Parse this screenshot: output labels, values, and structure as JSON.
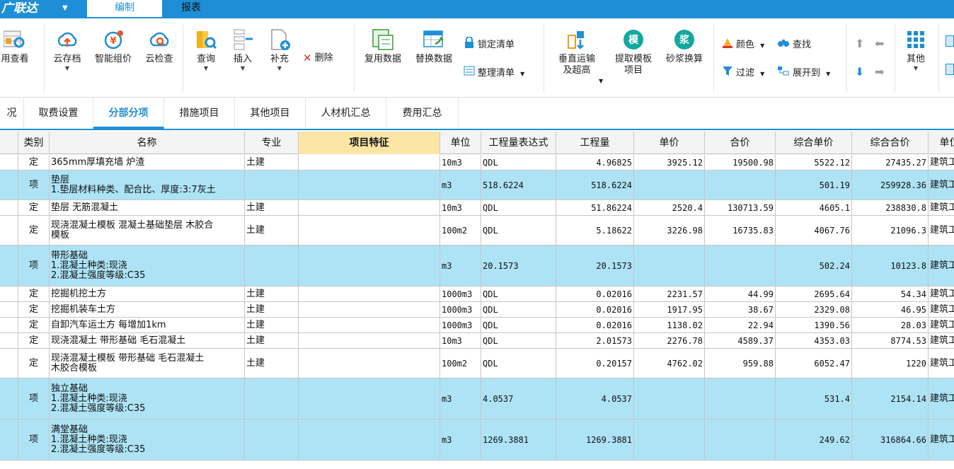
{
  "app": {
    "title": "广联达"
  },
  "menu": {
    "tab_edit": "编制",
    "tab_report": "报表"
  },
  "ribbon": {
    "b_view": "用查看",
    "b_cloud_save": "云存档",
    "b_smart_price": "智能组价",
    "b_cloud_check": "云检查",
    "b_query": "查询",
    "b_insert": "插入",
    "b_supplement": "补充",
    "b_delete": "删除",
    "b_reuse": "复用数据",
    "b_replace": "替换数据",
    "b_lock": "锁定清单",
    "b_arrange": "整理清单",
    "b_vertical_1": "垂直运输",
    "b_vertical_2": "及超高",
    "b_template_1": "提取模板",
    "b_template_2": "项目",
    "b_mortar": "砂浆换算",
    "mortar_glyph": "浆",
    "template_glyph": "模",
    "b_color": "颜色",
    "b_find": "查找",
    "b_filter": "过滤",
    "b_expand": "展开到",
    "b_other": "其他"
  },
  "subtabs": [
    "况",
    "取费设置",
    "分部分项",
    "措施项目",
    "其他项目",
    "人材机汇总",
    "费用汇总"
  ],
  "columns": [
    "",
    "类别",
    "名称",
    "专业",
    "项目特征",
    "单位",
    "工程量表达式",
    "工程量",
    "单价",
    "合价",
    "综合单价",
    "综合合价",
    "单位"
  ],
  "rows": [
    {
      "kind": "定",
      "name": "365mm厚填充墙 炉渣",
      "major": "土建",
      "unit": "10m3",
      "expr": "QDL",
      "qty": "4.96825",
      "price": "3925.12",
      "total": "19500.98",
      "cprice": "5522.12",
      "ctotal": "27435.27",
      "ext": "建筑工"
    },
    {
      "kind": "项",
      "name": "垫层\n1.垫层材料种类、配合比、厚度:3:7灰土",
      "major": "",
      "unit": "m3",
      "expr": "518.6224",
      "qty": "518.6224",
      "price": "",
      "total": "",
      "cprice": "501.19",
      "ctotal": "259928.36",
      "ext": "建筑工"
    },
    {
      "kind": "定",
      "name": "垫层 无筋混凝土",
      "major": "土建",
      "unit": "10m3",
      "expr": "QDL",
      "qty": "51.86224",
      "price": "2520.4",
      "total": "130713.59",
      "cprice": "4605.1",
      "ctotal": "238830.8",
      "ext": "建筑工"
    },
    {
      "kind": "定",
      "name": "现浇混凝土模板 混凝土基础垫层 木胶合\n模板",
      "major": "土建",
      "unit": "100m2",
      "expr": "QDL",
      "qty": "5.18622",
      "price": "3226.98",
      "total": "16735.83",
      "cprice": "4067.76",
      "ctotal": "21096.3",
      "ext": "建筑工"
    },
    {
      "kind": "项",
      "name": "带形基础\n1.混凝土种类:现浇\n2.混凝土强度等级:C35",
      "major": "",
      "unit": "m3",
      "expr": "20.1573",
      "qty": "20.1573",
      "price": "",
      "total": "",
      "cprice": "502.24",
      "ctotal": "10123.8",
      "ext": "建筑工"
    },
    {
      "kind": "定",
      "name": "挖掘机挖土方",
      "major": "土建",
      "unit": "1000m3",
      "expr": "QDL",
      "qty": "0.02016",
      "price": "2231.57",
      "total": "44.99",
      "cprice": "2695.64",
      "ctotal": "54.34",
      "ext": "建筑工"
    },
    {
      "kind": "定",
      "name": "挖掘机装车土方",
      "major": "土建",
      "unit": "1000m3",
      "expr": "QDL",
      "qty": "0.02016",
      "price": "1917.95",
      "total": "38.67",
      "cprice": "2329.08",
      "ctotal": "46.95",
      "ext": "建筑工"
    },
    {
      "kind": "定",
      "name": "自卸汽车运土方 每增加1km",
      "major": "土建",
      "unit": "1000m3",
      "expr": "QDL",
      "qty": "0.02016",
      "price": "1138.02",
      "total": "22.94",
      "cprice": "1390.56",
      "ctotal": "28.03",
      "ext": "建筑工"
    },
    {
      "kind": "定",
      "name": "现浇混凝土 带形基础 毛石混凝土",
      "major": "土建",
      "unit": "10m3",
      "expr": "QDL",
      "qty": "2.01573",
      "price": "2276.78",
      "total": "4589.37",
      "cprice": "4353.03",
      "ctotal": "8774.53",
      "ext": "建筑工"
    },
    {
      "kind": "定",
      "name": "现浇混凝土模板 带形基础 毛石混凝土\n木胶合模板",
      "major": "土建",
      "unit": "100m2",
      "expr": "QDL",
      "qty": "0.20157",
      "price": "4762.02",
      "total": "959.88",
      "cprice": "6052.47",
      "ctotal": "1220",
      "ext": "建筑工"
    },
    {
      "kind": "项",
      "name": "独立基础\n1.混凝土种类:现浇\n2.混凝土强度等级:C35",
      "major": "",
      "unit": "m3",
      "expr": "4.0537",
      "qty": "4.0537",
      "price": "",
      "total": "",
      "cprice": "531.4",
      "ctotal": "2154.14",
      "ext": "建筑工"
    },
    {
      "kind": "项",
      "name": "满堂基础\n1.混凝土种类:现浇\n2.混凝土强度等级:C35",
      "major": "",
      "unit": "m3",
      "expr": "1269.3881",
      "qty": "1269.3881",
      "price": "",
      "total": "",
      "cprice": "249.62",
      "ctotal": "316864.66",
      "ext": "建筑工"
    }
  ],
  "colors": {
    "accent": "#1e8fd6",
    "item_row": "#ade3f5",
    "header_highlight": "#fbe6a6"
  }
}
